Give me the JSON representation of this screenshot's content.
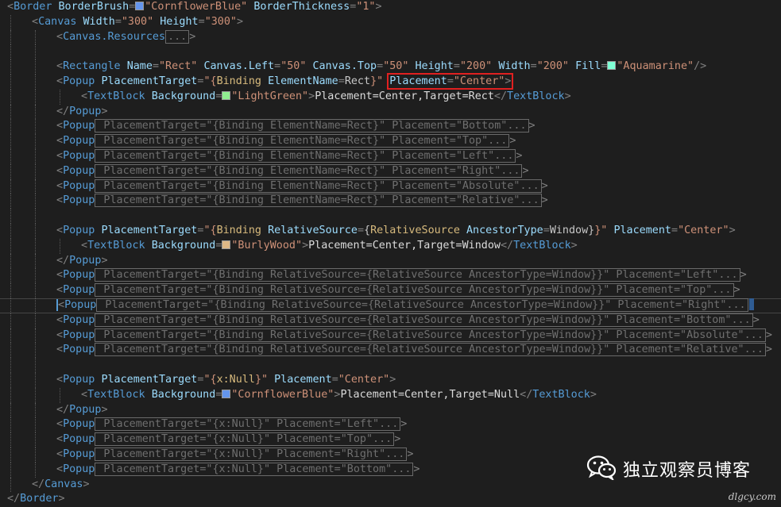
{
  "editor": {
    "lines": [
      {
        "indent": 0,
        "html": "<span class=\"d\">&lt;</span><span class=\"t\">Border</span> <span class=\"a\">BorderBrush</span><span class=\"d\">=</span><span class=\"sw\" style=\"background:#6495ed\"></span><span class=\"v\">\"CornflowerBlue\"</span> <span class=\"a\">BorderThickness</span><span class=\"d\">=</span><span class=\"v\">\"1\"</span><span class=\"d\">&gt;</span>"
      },
      {
        "indent": 1,
        "html": "<span class=\"d\">&lt;</span><span class=\"t\">Canvas</span> <span class=\"a\">Width</span><span class=\"d\">=</span><span class=\"v\">\"300\"</span> <span class=\"a\">Height</span><span class=\"d\">=</span><span class=\"v\">\"300\"</span><span class=\"d\">&gt;</span>"
      },
      {
        "indent": 2,
        "html": "<span class=\"d\">&lt;</span><span class=\"t\">Canvas.Resources</span><span class=\"fold\">...</span><span class=\"d\">&gt;</span>"
      },
      {
        "indent": 2,
        "html": ""
      },
      {
        "indent": 2,
        "html": "<span class=\"d\">&lt;</span><span class=\"t\">Rectangle</span> <span class=\"a\">Name</span><span class=\"d\">=</span><span class=\"v\">\"Rect\"</span> <span class=\"a\">Canvas.Left</span><span class=\"d\">=</span><span class=\"v\">\"50\"</span> <span class=\"a\">Canvas.Top</span><span class=\"d\">=</span><span class=\"v\">\"50\"</span> <span class=\"a\">Height</span><span class=\"d\">=</span><span class=\"v\">\"200\"</span> <span class=\"a\">Width</span><span class=\"d\">=</span><span class=\"v\">\"200\"</span> <span class=\"a\">Fill</span><span class=\"d\">=</span><span class=\"sw\" style=\"background:#7fffd4\"></span><span class=\"v\">\"Aquamarine\"</span><span class=\"d\">/&gt;</span>"
      },
      {
        "indent": 2,
        "html": "<span class=\"d\">&lt;</span><span class=\"t\">Popup</span> <span class=\"a\">PlacementTarget</span><span class=\"d\">=</span><span class=\"v\">\"{</span><span class=\"k\">Binding</span> <span class=\"a\">ElementName</span><span class=\"d\">=</span><span class=\"v2\">Rect</span><span class=\"v\">}\"</span> <span class=\"hl\"><span class=\"a\">Placement</span><span class=\"d\">=</span><span class=\"v\">\"Center\"</span><span class=\"d\">&gt;</span></span>"
      },
      {
        "indent": 3,
        "html": "<span class=\"d\">&lt;</span><span class=\"t\">TextBlock</span> <span class=\"a\">Background</span><span class=\"d\">=</span><span class=\"sw\" style=\"background:#90ee90\"></span><span class=\"v\">\"LightGreen\"</span><span class=\"d\">&gt;</span><span class=\"txt\">Placement=Center,Target=Rect</span><span class=\"d\">&lt;/</span><span class=\"t\">TextBlock</span><span class=\"d\">&gt;</span>"
      },
      {
        "indent": 2,
        "html": "<span class=\"d\">&lt;/</span><span class=\"t\">Popup</span><span class=\"d\">&gt;</span>"
      },
      {
        "indent": 2,
        "html": "<span class=\"d\">&lt;</span><span class=\"t\">Popup</span><span class=\"fold\"> PlacementTarget=\"{Binding ElementName=Rect}\" Placement=\"Bottom\"...</span><span class=\"d\">&gt;</span>"
      },
      {
        "indent": 2,
        "html": "<span class=\"d\">&lt;</span><span class=\"t\">Popup</span><span class=\"fold\"> PlacementTarget=\"{Binding ElementName=Rect}\" Placement=\"Top\"...</span><span class=\"d\">&gt;</span>"
      },
      {
        "indent": 2,
        "html": "<span class=\"d\">&lt;</span><span class=\"t\">Popup</span><span class=\"fold\"> PlacementTarget=\"{Binding ElementName=Rect}\" Placement=\"Left\"...</span><span class=\"d\">&gt;</span>"
      },
      {
        "indent": 2,
        "html": "<span class=\"d\">&lt;</span><span class=\"t\">Popup</span><span class=\"fold\"> PlacementTarget=\"{Binding ElementName=Rect}\" Placement=\"Right\"...</span><span class=\"d\">&gt;</span>"
      },
      {
        "indent": 2,
        "html": "<span class=\"d\">&lt;</span><span class=\"t\">Popup</span><span class=\"fold\"> PlacementTarget=\"{Binding ElementName=Rect}\" Placement=\"Absolute\"...</span><span class=\"d\">&gt;</span>"
      },
      {
        "indent": 2,
        "html": "<span class=\"d\">&lt;</span><span class=\"t\">Popup</span><span class=\"fold\"> PlacementTarget=\"{Binding ElementName=Rect}\" Placement=\"Relative\"...</span><span class=\"d\">&gt;</span>"
      },
      {
        "indent": 2,
        "html": ""
      },
      {
        "indent": 2,
        "html": "<span class=\"d\">&lt;</span><span class=\"t\">Popup</span> <span class=\"a\">PlacementTarget</span><span class=\"d\">=</span><span class=\"v\">\"{</span><span class=\"k\">Binding</span> <span class=\"a\">RelativeSource</span><span class=\"d\">=</span><span class=\"v2\">{</span><span class=\"k\">RelativeSource</span> <span class=\"a\">AncestorType</span><span class=\"d\">=</span><span class=\"v2\">Window}</span><span class=\"v\">}\"</span> <span class=\"a\">Placement</span><span class=\"d\">=</span><span class=\"v\">\"Center\"</span><span class=\"d\">&gt;</span>"
      },
      {
        "indent": 3,
        "html": "<span class=\"d\">&lt;</span><span class=\"t\">TextBlock</span> <span class=\"a\">Background</span><span class=\"d\">=</span><span class=\"sw\" style=\"background:#deb887\"></span><span class=\"v\">\"BurlyWood\"</span><span class=\"d\">&gt;</span><span class=\"txt\">Placement=Center,Target=Window</span><span class=\"d\">&lt;/</span><span class=\"t\">TextBlock</span><span class=\"d\">&gt;</span>"
      },
      {
        "indent": 2,
        "html": "<span class=\"d\">&lt;/</span><span class=\"t\">Popup</span><span class=\"d\">&gt;</span>"
      },
      {
        "indent": 2,
        "html": "<span class=\"d\">&lt;</span><span class=\"t\">Popup</span><span class=\"fold\"> PlacementTarget=\"{Binding RelativeSource={RelativeSource AncestorType=Window}}\" Placement=\"Left\"...</span><span class=\"d\">&gt;</span>"
      },
      {
        "indent": 2,
        "html": "<span class=\"d\">&lt;</span><span class=\"t\">Popup</span><span class=\"fold\"> PlacementTarget=\"{Binding RelativeSource={RelativeSource AncestorType=Window}}\" Placement=\"Top\"...</span><span class=\"d\">&gt;</span>"
      },
      {
        "indent": 2,
        "current": true,
        "html": "<span class=\"d caretbar\">&lt;</span><span class=\"t\">Popup</span><span class=\"fold\"> PlacementTarget=\"{Binding RelativeSource={RelativeSource AncestorType=Window}}\" Placement=\"Right\"...</span><span class=\"endmark\"></span>"
      },
      {
        "indent": 2,
        "html": "<span class=\"d\">&lt;</span><span class=\"t\">Popup</span><span class=\"fold\"> PlacementTarget=\"{Binding RelativeSource={RelativeSource AncestorType=Window}}\" Placement=\"Bottom\"...</span><span class=\"d\">&gt;</span>"
      },
      {
        "indent": 2,
        "html": "<span class=\"d\">&lt;</span><span class=\"t\">Popup</span><span class=\"fold\"> PlacementTarget=\"{Binding RelativeSource={RelativeSource AncestorType=Window}}\" Placement=\"Absolute\"...</span><span class=\"d\">&gt;</span>"
      },
      {
        "indent": 2,
        "html": "<span class=\"d\">&lt;</span><span class=\"t\">Popup</span><span class=\"fold\"> PlacementTarget=\"{Binding RelativeSource={RelativeSource AncestorType=Window}}\" Placement=\"Relative\"...</span><span class=\"d\">&gt;</span>"
      },
      {
        "indent": 2,
        "html": ""
      },
      {
        "indent": 2,
        "html": "<span class=\"d\">&lt;</span><span class=\"t\">Popup</span> <span class=\"a\">PlacementTarget</span><span class=\"d\">=</span><span class=\"v\">\"{</span><span class=\"k\">x:Null</span><span class=\"v\">}\"</span> <span class=\"a\">Placement</span><span class=\"d\">=</span><span class=\"v\">\"Center\"</span><span class=\"d\">&gt;</span>"
      },
      {
        "indent": 3,
        "html": "<span class=\"d\">&lt;</span><span class=\"t\">TextBlock</span> <span class=\"a\">Background</span><span class=\"d\">=</span><span class=\"sw\" style=\"background:#6495ed\"></span><span class=\"v\">\"CornflowerBlue\"</span><span class=\"d\">&gt;</span><span class=\"txt\">Placement=Center,Target=Null</span><span class=\"d\">&lt;/</span><span class=\"t\">TextBlock</span><span class=\"d\">&gt;</span>"
      },
      {
        "indent": 2,
        "html": "<span class=\"d\">&lt;/</span><span class=\"t\">Popup</span><span class=\"d\">&gt;</span>"
      },
      {
        "indent": 2,
        "html": "<span class=\"d\">&lt;</span><span class=\"t\">Popup</span><span class=\"fold\"> PlacementTarget=\"{x:Null}\" Placement=\"Left\"...</span><span class=\"d\">&gt;</span>"
      },
      {
        "indent": 2,
        "html": "<span class=\"d\">&lt;</span><span class=\"t\">Popup</span><span class=\"fold\"> PlacementTarget=\"{x:Null}\" Placement=\"Top\"...</span><span class=\"d\">&gt;</span>"
      },
      {
        "indent": 2,
        "html": "<span class=\"d\">&lt;</span><span class=\"t\">Popup</span><span class=\"fold\"> PlacementTarget=\"{x:Null}\" Placement=\"Right\"...</span><span class=\"d\">&gt;</span>"
      },
      {
        "indent": 2,
        "html": "<span class=\"d\">&lt;</span><span class=\"t\">Popup</span><span class=\"fold\"> PlacementTarget=\"{x:Null}\" Placement=\"Bottom\"...</span><span class=\"d\">&gt;</span>"
      },
      {
        "indent": 1,
        "html": "<span class=\"d\">&lt;/</span><span class=\"t\">Canvas</span><span class=\"d\">&gt;</span>"
      },
      {
        "indent": 0,
        "html": "<span class=\"d\">&lt;/</span><span class=\"t\">Border</span><span class=\"d\">&gt;</span>"
      }
    ]
  },
  "watermark": {
    "icon": "wechat-icon",
    "text": "独立观察员博客"
  },
  "site": {
    "text": "dlgcy.com"
  },
  "colors": {
    "background": "#1e1e1e",
    "highlight_box": "#e02020"
  }
}
